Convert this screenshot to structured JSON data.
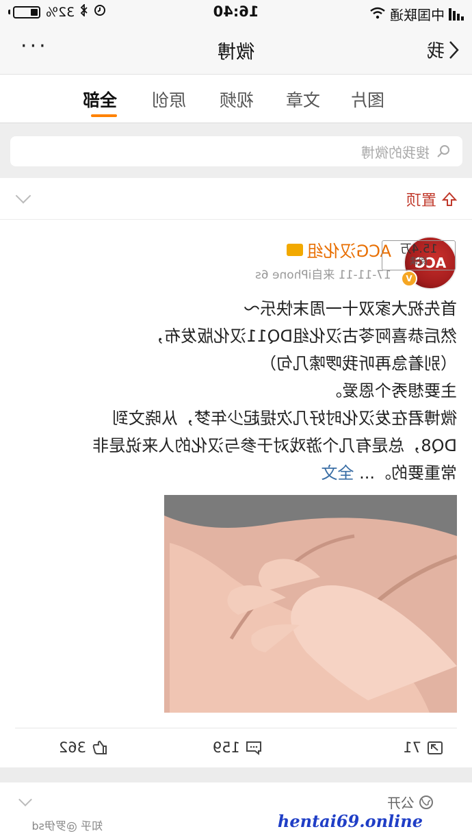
{
  "status_bar": {
    "carrier": "中国联通",
    "time": "16:40",
    "battery_percent": "32%",
    "battery_level": 0.32
  },
  "nav": {
    "back_label": "我",
    "title": "微博",
    "more_label": "···"
  },
  "tabs": [
    {
      "label": "全部",
      "active": true
    },
    {
      "label": "原创",
      "active": false
    },
    {
      "label": "视频",
      "active": false
    },
    {
      "label": "文章",
      "active": false
    },
    {
      "label": "图片",
      "active": false
    }
  ],
  "search": {
    "placeholder": "搜我的微博"
  },
  "pinned": {
    "label": "置顶"
  },
  "post": {
    "username": "ACG汉化组",
    "avatar_text": "ACG",
    "meta": "17-11-11  来自iPhone 6s",
    "read_count": "15.4万",
    "read_label": "阅读",
    "lines": [
      "首先祝大家双十一周末快乐～",
      "然后恭喜阿苓古汉化组DQ11汉化版发布，",
      "（别着急再听我啰嗦几句）",
      "主要想秀个恩爱。",
      "微博君在发汉化时好几次提起少年梦，从晓文到",
      "DQ8，总是有几个游戏对于参与汉化的人来说是非",
      "常重要的。..."
    ],
    "full_text_label": "全文",
    "repost_count": "71",
    "comment_count": "159",
    "like_count": "362"
  },
  "next_post": {
    "visibility_label": "公开"
  },
  "watermarks": {
    "site": "hentai69.online",
    "zhihu": "知乎 @罗伊sd"
  },
  "colors": {
    "accent": "#ff8200",
    "username": "#e86e00",
    "link": "#3a6ea5",
    "pin": "#c0392b"
  }
}
